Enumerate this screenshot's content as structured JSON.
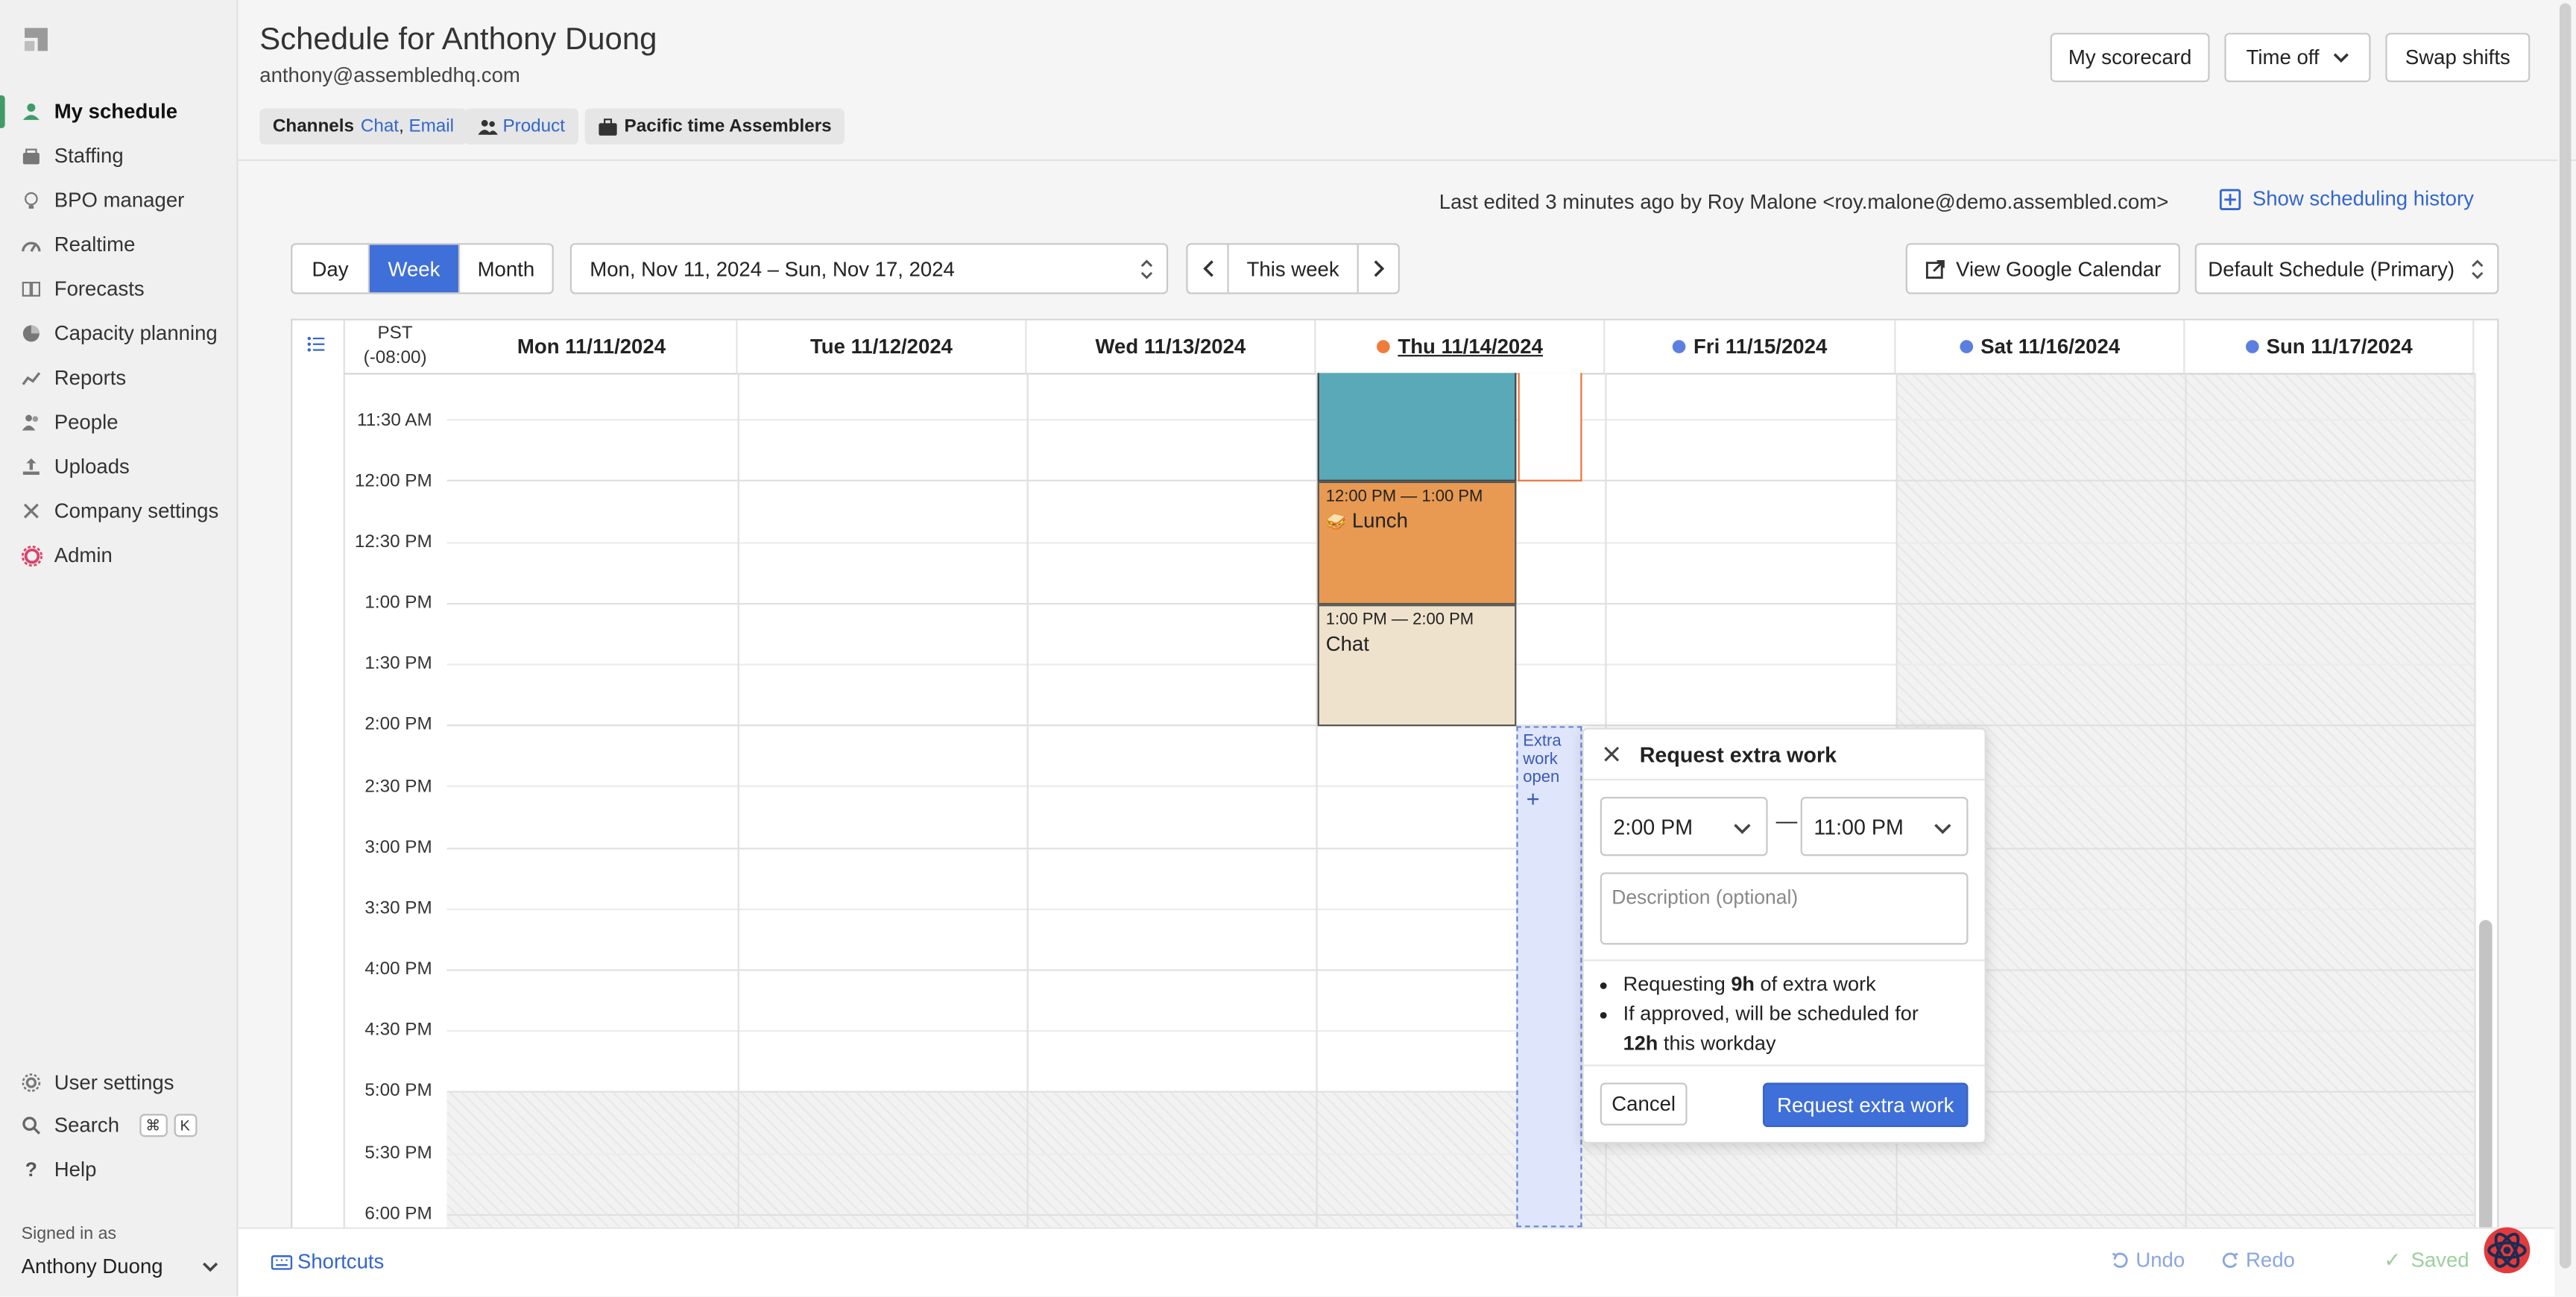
{
  "sidebar": {
    "items": [
      {
        "label": "My schedule",
        "icon": "person-icon"
      },
      {
        "label": "Staffing",
        "icon": "staffing-icon"
      },
      {
        "label": "BPO manager",
        "icon": "lightbulb-icon"
      },
      {
        "label": "Realtime",
        "icon": "gauge-icon"
      },
      {
        "label": "Forecasts",
        "icon": "book-icon"
      },
      {
        "label": "Capacity planning",
        "icon": "pie-icon"
      },
      {
        "label": "Reports",
        "icon": "trend-icon"
      },
      {
        "label": "People",
        "icon": "people-icon"
      },
      {
        "label": "Uploads",
        "icon": "upload-icon"
      },
      {
        "label": "Company settings",
        "icon": "tools-icon"
      },
      {
        "label": "Admin",
        "icon": "gear-icon"
      }
    ],
    "bottom": {
      "user_settings": "User settings",
      "search": "Search",
      "search_kbd_1": "⌘",
      "search_kbd_2": "K",
      "help": "Help",
      "signed_in_as": "Signed in as",
      "user_name": "Anthony Duong"
    }
  },
  "header": {
    "title": "Schedule for Anthony Duong",
    "email": "anthony@assembledhq.com",
    "buttons": {
      "scorecard": "My scorecard",
      "time_off": "Time off",
      "swap": "Swap shifts"
    },
    "chips": {
      "channels_label": "Channels",
      "channel_chat": "Chat",
      "channel_sep": ",",
      "channel_email": "Email",
      "team": "Product",
      "site": "Pacific time Assemblers"
    }
  },
  "history": {
    "last_edited": "Last edited 3 minutes ago by Roy Malone <roy.malone@demo.assembled.com>",
    "show_history": "Show scheduling history"
  },
  "toolbar": {
    "views": [
      "Day",
      "Week",
      "Month"
    ],
    "active_view": "Week",
    "date_range": "Mon, Nov 11, 2024 – Sun, Nov 17, 2024",
    "this_week": "This week",
    "google_cal": "View Google Calendar",
    "schedule_select": "Default Schedule (Primary)"
  },
  "calendar": {
    "timezone": "PST",
    "timezone_offset": "(-08:00)",
    "days": [
      {
        "label": "Mon 11/11/2024",
        "dot": ""
      },
      {
        "label": "Tue 11/12/2024",
        "dot": ""
      },
      {
        "label": "Wed 11/13/2024",
        "dot": ""
      },
      {
        "label": "Thu 11/14/2024",
        "dot": "#f07c3c"
      },
      {
        "label": "Fri 11/15/2024",
        "dot": "#5b7fe0"
      },
      {
        "label": "Sat 11/16/2024",
        "dot": "#5b7fe0"
      },
      {
        "label": "Sun 11/17/2024",
        "dot": "#5b7fe0"
      }
    ],
    "times": [
      "11:30 AM",
      "12:00 PM",
      "12:30 PM",
      "1:00 PM",
      "1:30 PM",
      "2:00 PM",
      "2:30 PM",
      "3:00 PM",
      "3:30 PM",
      "4:00 PM",
      "4:30 PM",
      "5:00 PM",
      "5:30 PM",
      "6:00 PM"
    ],
    "events": {
      "lunch_time": "12:00 PM — 1:00 PM",
      "lunch_name": "Lunch",
      "chat_time": "1:00 PM — 2:00 PM",
      "chat_name": "Chat",
      "extra_open": "Extra work open",
      "extra_plus": "+"
    },
    "colors": {
      "teal": "#5aa9b8",
      "lunch": "#e89a52",
      "chat": "#efe2cc",
      "extra": "#dfe6fb"
    }
  },
  "popover": {
    "title": "Request extra work",
    "start": "2:00 PM",
    "dash": "—",
    "end": "11:00 PM",
    "description_placeholder": "Description (optional)",
    "requesting_pre": "Requesting ",
    "requesting_bold": "9h",
    "requesting_post": " of extra work",
    "approved_pre": "If approved, will be scheduled for",
    "approved_bold": "12h",
    "approved_post": " this workday",
    "cancel": "Cancel",
    "submit": "Request extra work"
  },
  "footer": {
    "shortcuts": "Shortcuts",
    "undo": "Undo",
    "redo": "Redo",
    "saved": "Saved"
  }
}
